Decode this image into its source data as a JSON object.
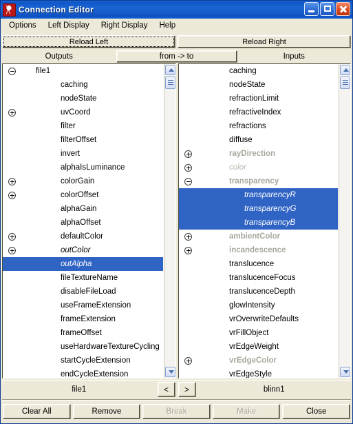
{
  "window": {
    "title": "Connection Editor",
    "icon": "maya-app-icon",
    "buttons": {
      "minimize": "minimize-icon",
      "maximize": "maximize-icon",
      "close": "close-icon"
    }
  },
  "menubar": {
    "items": [
      "Options",
      "Left Display",
      "Right Display",
      "Help"
    ]
  },
  "toolbar": {
    "reload_left": "Reload Left",
    "reload_right": "Reload Right"
  },
  "columns": {
    "outputs": "Outputs",
    "from_to": "from -> to",
    "inputs": "Inputs"
  },
  "left_pane": {
    "node": "file1",
    "rows": [
      {
        "label": "file1",
        "toggle": "minus",
        "root": true
      },
      {
        "label": "caching",
        "toggle": null
      },
      {
        "label": "nodeState",
        "toggle": null
      },
      {
        "label": "uvCoord",
        "toggle": "plus"
      },
      {
        "label": "filter",
        "toggle": null
      },
      {
        "label": "filterOffset",
        "toggle": null
      },
      {
        "label": "invert",
        "toggle": null
      },
      {
        "label": "alphaIsLuminance",
        "toggle": null
      },
      {
        "label": "colorGain",
        "toggle": "plus"
      },
      {
        "label": "colorOffset",
        "toggle": "plus"
      },
      {
        "label": "alphaGain",
        "toggle": null
      },
      {
        "label": "alphaOffset",
        "toggle": null
      },
      {
        "label": "defaultColor",
        "toggle": "plus"
      },
      {
        "label": "outColor",
        "toggle": "plus",
        "style": "italic"
      },
      {
        "label": "outAlpha",
        "toggle": null,
        "style": "italic",
        "selected": true
      },
      {
        "label": "fileTextureName",
        "toggle": null
      },
      {
        "label": "disableFileLoad",
        "toggle": null
      },
      {
        "label": "useFrameExtension",
        "toggle": null
      },
      {
        "label": "frameExtension",
        "toggle": null
      },
      {
        "label": "frameOffset",
        "toggle": null
      },
      {
        "label": "useHardwareTextureCycling",
        "toggle": null
      },
      {
        "label": "startCycleExtension",
        "toggle": null
      },
      {
        "label": "endCycleExtension",
        "toggle": null
      }
    ]
  },
  "right_pane": {
    "node": "blinn1",
    "rows": [
      {
        "label": "caching",
        "toggle": null
      },
      {
        "label": "nodeState",
        "toggle": null
      },
      {
        "label": "refractionLimit",
        "toggle": null
      },
      {
        "label": "refractiveIndex",
        "toggle": null
      },
      {
        "label": "refractions",
        "toggle": null
      },
      {
        "label": "diffuse",
        "toggle": null
      },
      {
        "label": "rayDirection",
        "toggle": "plus",
        "style": "gray"
      },
      {
        "label": "color",
        "toggle": "plus",
        "style": "grayitalic"
      },
      {
        "label": "transparency",
        "toggle": "minus",
        "style": "gray"
      },
      {
        "label": "transparencyR",
        "toggle": null,
        "style": "italic",
        "selected": true,
        "indent": 2
      },
      {
        "label": "transparencyG",
        "toggle": null,
        "style": "italic",
        "selected": true,
        "indent": 2
      },
      {
        "label": "transparencyB",
        "toggle": null,
        "style": "italic",
        "selected": true,
        "indent": 2
      },
      {
        "label": "ambientColor",
        "toggle": "plus",
        "style": "gray"
      },
      {
        "label": "incandescence",
        "toggle": "plus",
        "style": "gray"
      },
      {
        "label": "translucence",
        "toggle": null
      },
      {
        "label": "translucenceFocus",
        "toggle": null
      },
      {
        "label": "translucenceDepth",
        "toggle": null
      },
      {
        "label": "glowIntensity",
        "toggle": null
      },
      {
        "label": "vrOverwriteDefaults",
        "toggle": null
      },
      {
        "label": "vrFillObject",
        "toggle": null
      },
      {
        "label": "vrEdgeWeight",
        "toggle": null
      },
      {
        "label": "vrEdgeColor",
        "toggle": "plus",
        "style": "gray"
      },
      {
        "label": "vrEdgeStyle",
        "toggle": null
      }
    ]
  },
  "nav": {
    "prev": "<",
    "next": ">"
  },
  "actions": [
    {
      "label": "Clear All",
      "name": "clear-all-button",
      "disabled": false
    },
    {
      "label": "Remove",
      "name": "remove-button",
      "disabled": false
    },
    {
      "label": "Break",
      "name": "break-button",
      "disabled": true
    },
    {
      "label": "Make",
      "name": "make-button",
      "disabled": true
    },
    {
      "label": "Close",
      "name": "close-button",
      "disabled": false
    }
  ],
  "colors": {
    "titlebar": "#1559c9",
    "selection": "#2f63c4",
    "face": "#ece9d8",
    "disabled_text": "#a7a391",
    "gray_attr": "#a8a79c"
  }
}
